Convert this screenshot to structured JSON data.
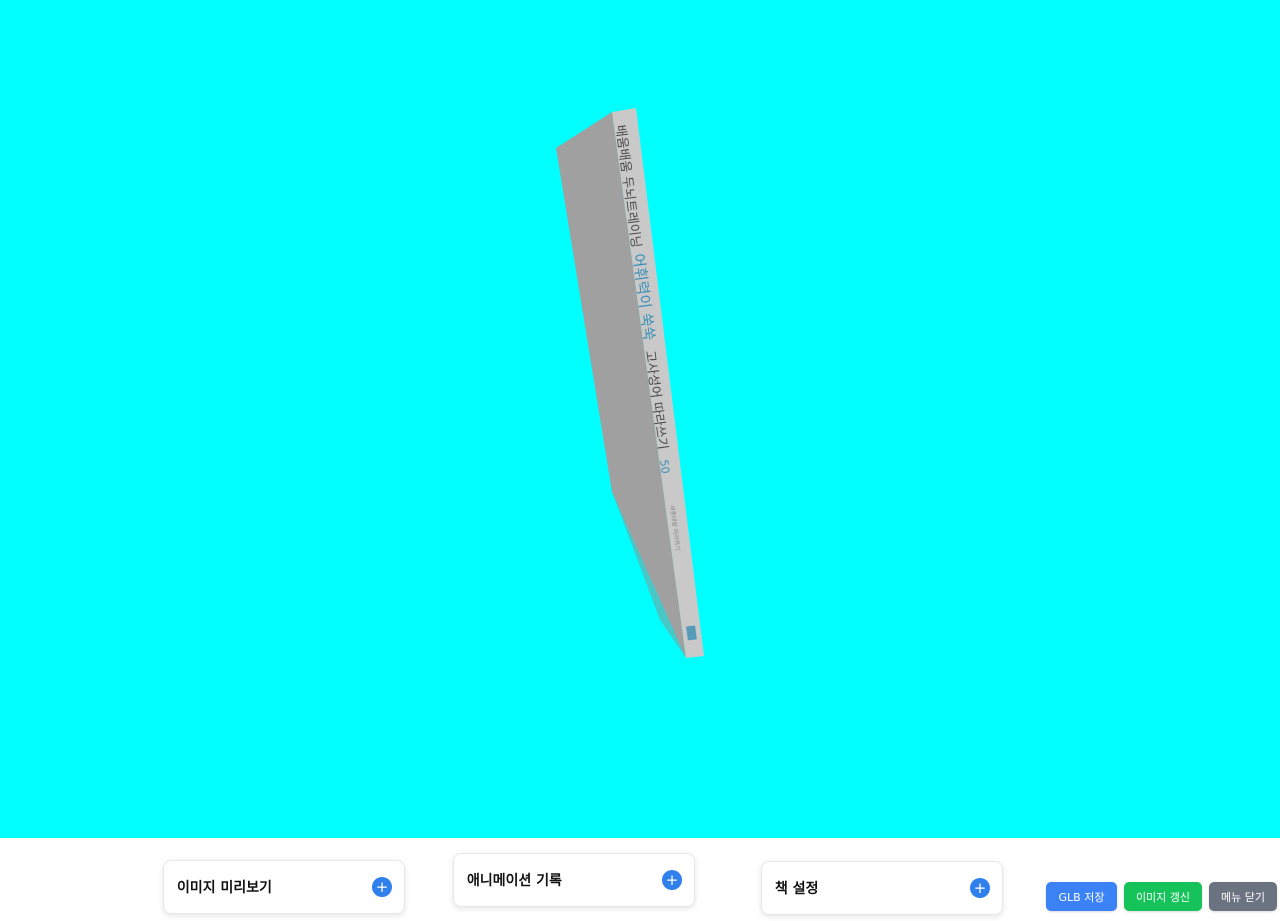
{
  "scene": {
    "background_color": "#00ffff",
    "book": {
      "spine_text_main": "배움배움 두뇌트레이닝",
      "spine_text_accent": "어휘력이 쑥쑥",
      "spine_text_sub": "고사성어 따라쓰기",
      "spine_number": "50",
      "spine_publisher": "세종대왕 따라하기",
      "cover_color": "#a0a0a0",
      "spine_color": "#c9c9c9"
    }
  },
  "panels": {
    "image_preview": {
      "title": "이미지 미리보기",
      "add_label": "+"
    },
    "animation_record": {
      "title": "애니메이션 기록",
      "add_label": "+"
    },
    "book_settings": {
      "title": "책 설정",
      "add_label": "+"
    }
  },
  "actions": {
    "save_glb": {
      "label": "GLB 저장",
      "color": "#3b82f6"
    },
    "refresh_image": {
      "label": "이미지 갱신",
      "color": "#16c35a"
    },
    "close_menu": {
      "label": "메뉴 닫기",
      "color": "#6b7280"
    }
  }
}
